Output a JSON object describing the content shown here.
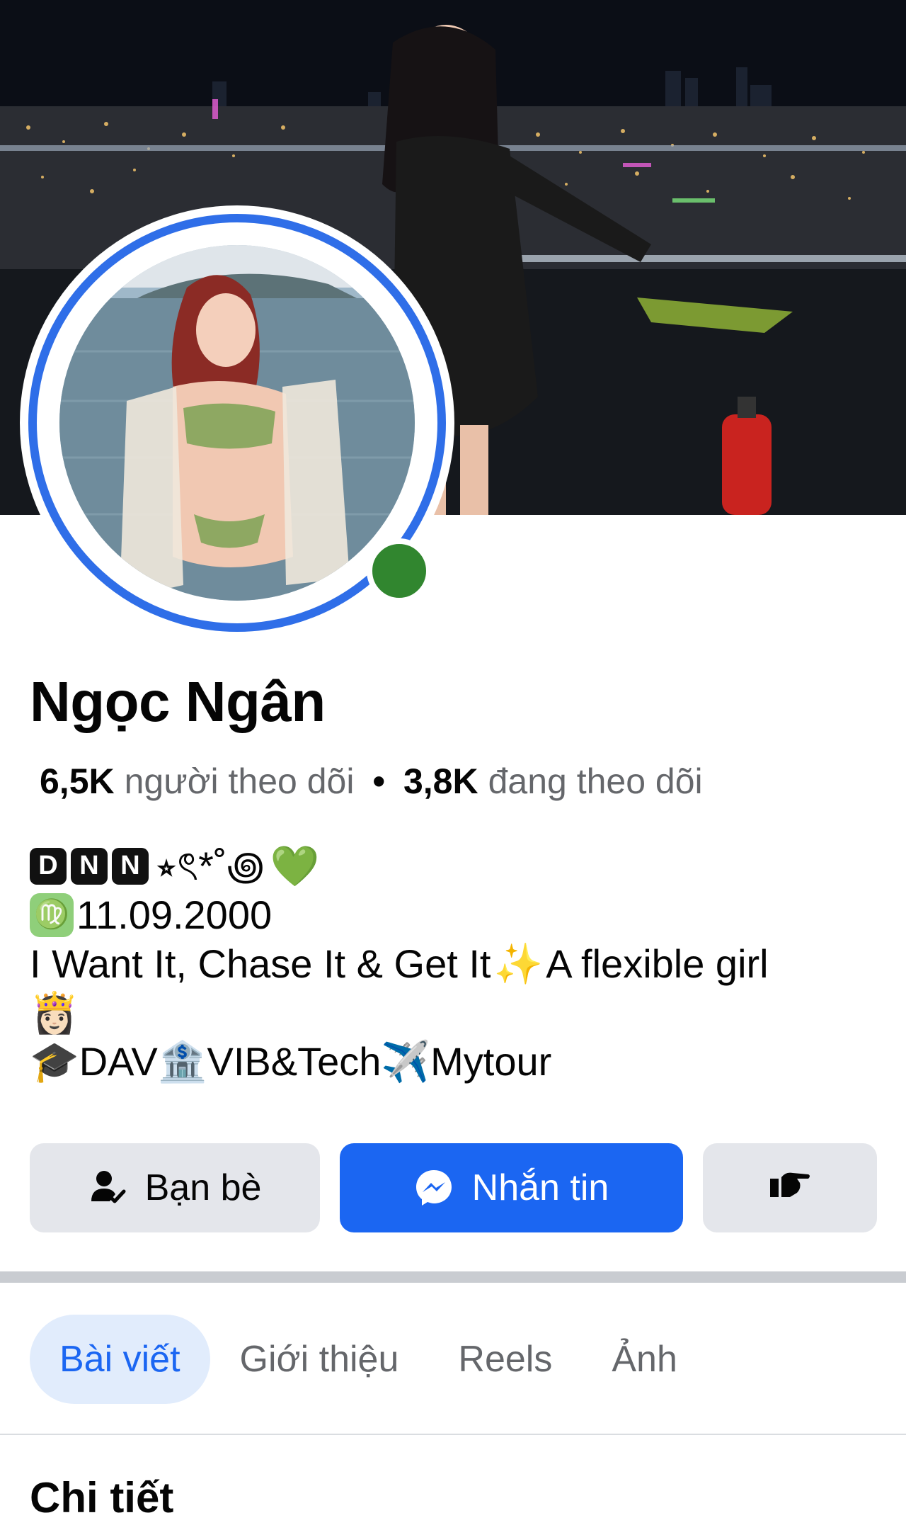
{
  "profile": {
    "name": "Ngọc Ngân",
    "followers_count": "6,5K",
    "followers_label": "người theo dõi",
    "separator": "•",
    "following_count": "3,8K",
    "following_label": "đang theo dõi",
    "online": true
  },
  "bio": {
    "line1_letters": [
      "D",
      "N",
      "N"
    ],
    "line1_symbols": "⭒ৎ*˚꩜",
    "line1_heart": "💚",
    "line2_sign": "♍",
    "line2_text": "11.09.2000",
    "line3_text": "I Want It, Chase It & Get It",
    "line3_sparkle": "✨",
    "line3_text2": "A flexible girl",
    "line4_emoji": "👸🏻",
    "line5_cap": "🎓",
    "line5_a": "DAV",
    "line5_bank": "🏦",
    "line5_b": "VIB&Tech",
    "line5_plane": "✈️",
    "line5_c": "Mytour"
  },
  "actions": {
    "friends_label": "Bạn bè",
    "message_label": "Nhắn tin",
    "more_icon": "pointing-hand-icon"
  },
  "tabs": [
    {
      "label": "Bài viết",
      "active": true
    },
    {
      "label": "Giới thiệu",
      "active": false
    },
    {
      "label": "Reels",
      "active": false
    },
    {
      "label": "Ảnh",
      "active": false
    }
  ],
  "section": {
    "title": "Chi tiết"
  },
  "colors": {
    "accent": "#1b66f2",
    "ring": "#2f6ee8",
    "online": "#31862f",
    "button_grey": "#e4e6eb",
    "tab_active_bg": "#e1ecfc"
  }
}
